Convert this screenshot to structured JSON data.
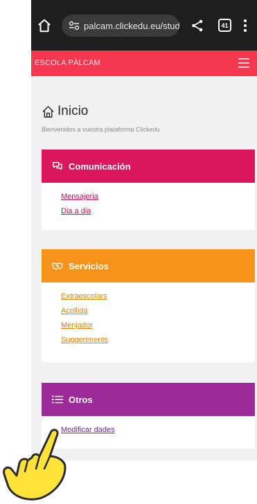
{
  "browser": {
    "url": "palcam.clickedu.eu/stude",
    "tab_count": "41"
  },
  "app": {
    "title": "ESCOLA PÀLCAM"
  },
  "page": {
    "title": "Inicio",
    "subtitle": "Bienvenidos a vuestra plataforma Clickedu"
  },
  "sections": {
    "comunicacion": {
      "title": "Comunicación",
      "color": "#d9175d",
      "links": [
        "Mensajeria",
        "Dia a dia"
      ]
    },
    "servicios": {
      "title": "Servicios",
      "color": "#f7931a",
      "links": [
        "Extraescolars",
        "Acollida",
        "Menjador",
        "Suggeriments"
      ]
    },
    "otros": {
      "title": "Otros",
      "color": "#9c2a98",
      "links": [
        "Modificar dades"
      ]
    }
  },
  "icons": {
    "browser": [
      "home-icon",
      "site-settings-icon",
      "share-icon",
      "tabs-icon",
      "more-menu-icon"
    ],
    "header": [
      "hamburger-menu-icon"
    ],
    "page": [
      "house-icon",
      "chat-icon",
      "handshake-icon",
      "list-icon",
      "pointing-hand-icon"
    ]
  }
}
